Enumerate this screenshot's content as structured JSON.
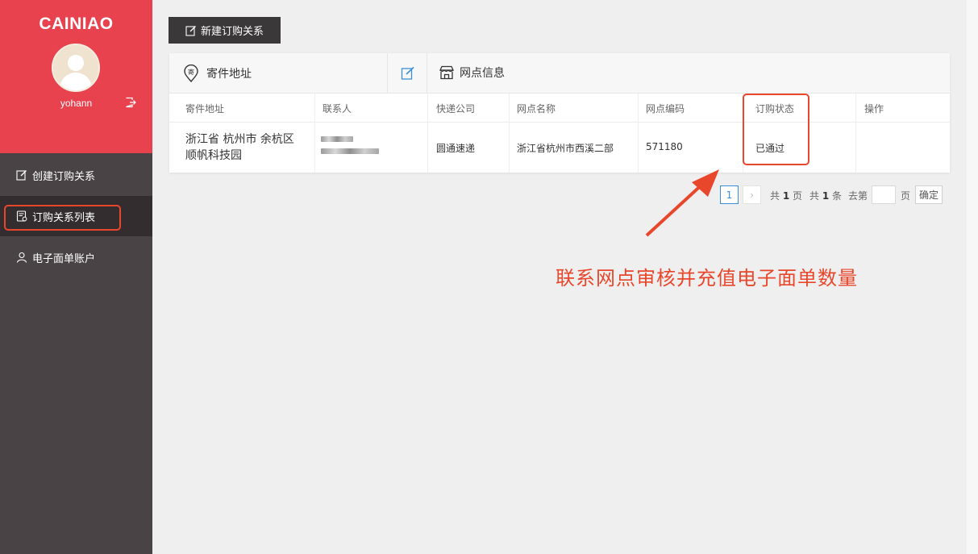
{
  "sidebar": {
    "logo": "CAINIAO",
    "username": "yohann",
    "items": [
      {
        "label": "创建订购关系",
        "icon": "edit-icon"
      },
      {
        "label": "订购关系列表",
        "icon": "list-icon"
      },
      {
        "label": "电子面单账户",
        "icon": "user-icon"
      }
    ]
  },
  "toolbar": {
    "new_label": "新建订购关系"
  },
  "card": {
    "address_title": "寄件地址",
    "site_title": "网点信息",
    "columns": [
      "寄件地址",
      "联系人",
      "快递公司",
      "网点名称",
      "网点编码",
      "订购状态",
      "操作"
    ],
    "row": {
      "address_line1": "浙江省 杭州市 余杭区",
      "address_line2": "顺帆科技园",
      "company": "圆通速递",
      "site_name": "浙江省杭州市西溪二部",
      "site_code": "571180",
      "status": "已通过"
    }
  },
  "pagination": {
    "current": "1",
    "next": "›",
    "total_pages_prefix": "共",
    "total_pages": "1",
    "total_pages_suffix": "页",
    "total_items_prefix": "共",
    "total_items": "1",
    "total_items_suffix": "条",
    "goto_prefix": "去第",
    "goto_suffix": "页",
    "confirm": "确定"
  },
  "annotation": "联系网点审核并充值电子面单数量",
  "colors": {
    "brand": "#e9424f",
    "sidebar": "#4a4345",
    "highlight": "#e8472c",
    "link": "#3b8fd8"
  }
}
